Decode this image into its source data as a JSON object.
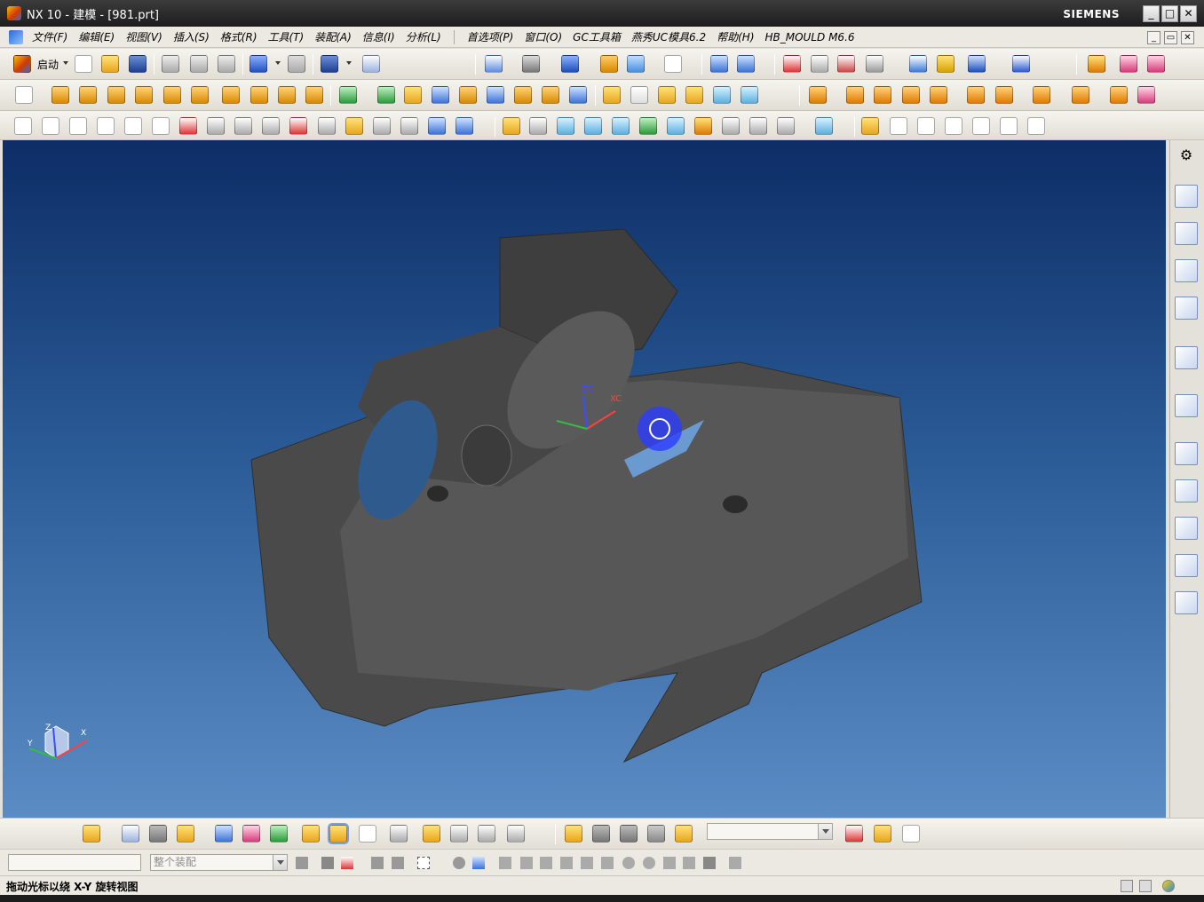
{
  "window": {
    "title": "NX 10 - 建模 - [981.prt]",
    "brand": "SIEMENS",
    "minimize": "_",
    "maximize": "□",
    "close": "✕"
  },
  "menu": {
    "items": [
      "文件(F)",
      "编辑(E)",
      "视图(V)",
      "插入(S)",
      "格式(R)",
      "工具(T)",
      "装配(A)",
      "信息(I)",
      "分析(L)"
    ],
    "items2": [
      "首选项(P)",
      "窗口(O)",
      "GC工具箱",
      "燕秀UC模具6.2",
      "帮助(H)",
      "HB_MOULD M6.6"
    ]
  },
  "toolbar": {
    "start_label": "启动"
  },
  "viewport": {
    "triad_zc": "ZC",
    "triad_xc": "XC",
    "view_z": "Z",
    "view_x": "X",
    "view_y": "Y"
  },
  "selection_bar": {
    "filter_value": "",
    "scope_placeholder": "整个装配"
  },
  "status": {
    "message": "拖动光标以绕 X-Y 旋转视图"
  },
  "colors": {
    "titlebar": "#1c1c1c",
    "viewport_top": "#0d2d66",
    "viewport_bottom": "#5b8cc4",
    "part": "#4a4a4a",
    "rotate_cursor": "#2d3cff"
  }
}
